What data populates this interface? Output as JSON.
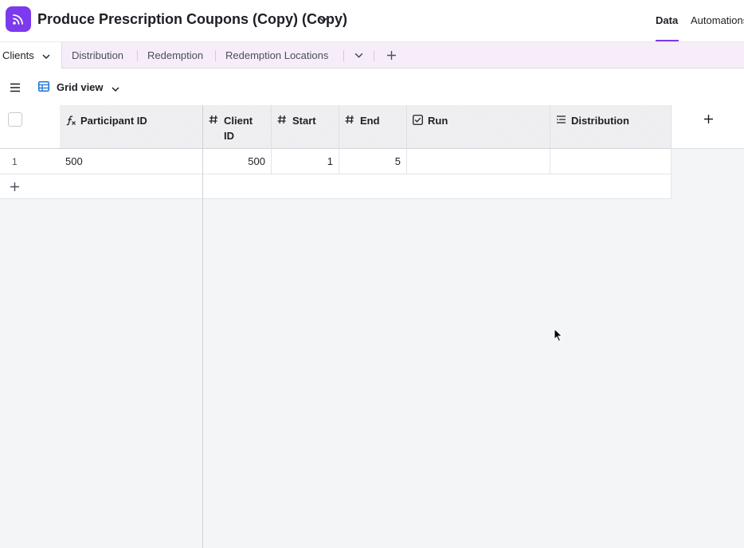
{
  "header": {
    "base_title": "Produce Prescription Coupons (Copy) (Copy)",
    "tabs": [
      {
        "label": "Data",
        "active": true
      },
      {
        "label": "Automations",
        "active": false
      }
    ]
  },
  "tables": {
    "items": [
      {
        "label": "Clients",
        "active": true
      },
      {
        "label": "Distribution",
        "active": false
      },
      {
        "label": "Redemption",
        "active": false
      },
      {
        "label": "Redemption Locations",
        "active": false
      }
    ]
  },
  "view": {
    "name": "Grid view"
  },
  "grid": {
    "columns": [
      {
        "label": "Participant ID",
        "type": "formula",
        "icon": "formula-icon"
      },
      {
        "label": "Client ID",
        "type": "number",
        "icon": "hash-icon"
      },
      {
        "label": "Start",
        "type": "number",
        "icon": "hash-icon"
      },
      {
        "label": "End",
        "type": "number",
        "icon": "hash-icon"
      },
      {
        "label": "Run",
        "type": "checkbox",
        "icon": "checkbox-icon"
      },
      {
        "label": "Distribution",
        "type": "link",
        "icon": "link-list-icon"
      }
    ],
    "rows": [
      {
        "number": "1",
        "participant_id": "500",
        "client_id": "500",
        "start": "1",
        "end": "5",
        "run": "",
        "distribution": ""
      }
    ]
  },
  "colors": {
    "accent": "#7c3aed",
    "table_bar": "#f6edf8",
    "view_icon": "#1b73d4"
  }
}
